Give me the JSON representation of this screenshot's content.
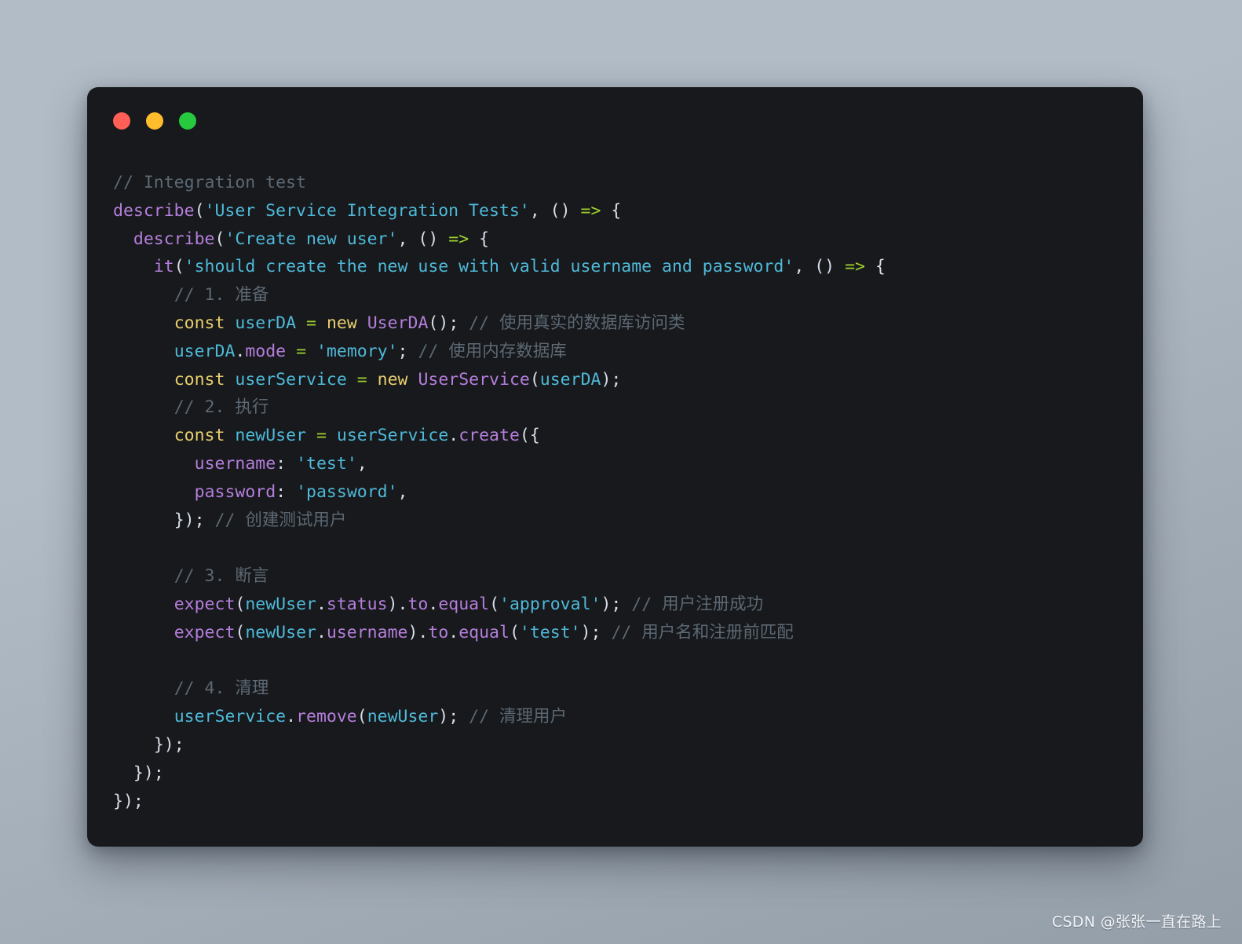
{
  "window": {
    "traffic_lights": [
      {
        "name": "close",
        "color": "#ff5f56"
      },
      {
        "name": "minimize",
        "color": "#ffbd2e"
      },
      {
        "name": "maximize",
        "color": "#27c93f"
      }
    ],
    "background_color": "#17191c"
  },
  "theme": {
    "page_background_start": "#b2bcc6",
    "page_background_end": "#949ea8",
    "comment": "#5c6873",
    "keyword": "#e8cf6e",
    "identifier": "#4fb9d8",
    "string": "#4fb9d8",
    "function": "#b57edc",
    "operator": "#9fd02f",
    "punctuation": "#d8dee9"
  },
  "code": {
    "language": "javascript",
    "lines": [
      {
        "n": 1,
        "text": "// Integration test"
      },
      {
        "n": 2,
        "text": "describe('User Service Integration Tests', () => {"
      },
      {
        "n": 3,
        "text": "  describe('Create new user', () => {"
      },
      {
        "n": 4,
        "text": "    it('should create the new use with valid username and password', () => {"
      },
      {
        "n": 5,
        "text": "      // 1. 准备"
      },
      {
        "n": 6,
        "text": "      const userDA = new UserDA(); // 使用真实的数据库访问类"
      },
      {
        "n": 7,
        "text": "      userDA.mode = 'memory'; // 使用内存数据库"
      },
      {
        "n": 8,
        "text": "      const userService = new UserService(userDA);"
      },
      {
        "n": 9,
        "text": "      // 2. 执行"
      },
      {
        "n": 10,
        "text": "      const newUser = userService.create({"
      },
      {
        "n": 11,
        "text": "        username: 'test',"
      },
      {
        "n": 12,
        "text": "        password: 'password',"
      },
      {
        "n": 13,
        "text": "      }); // 创建测试用户"
      },
      {
        "n": 14,
        "text": ""
      },
      {
        "n": 15,
        "text": "      // 3. 断言"
      },
      {
        "n": 16,
        "text": "      expect(newUser.status).to.equal('approval'); // 用户注册成功"
      },
      {
        "n": 17,
        "text": "      expect(newUser.username).to.equal('test'); // 用户名和注册前匹配"
      },
      {
        "n": 18,
        "text": ""
      },
      {
        "n": 19,
        "text": "      // 4. 清理"
      },
      {
        "n": 20,
        "text": "      userService.remove(newUser); // 清理用户"
      },
      {
        "n": 21,
        "text": "    });"
      },
      {
        "n": 22,
        "text": "  });"
      },
      {
        "n": 23,
        "text": "});"
      }
    ]
  },
  "watermark": {
    "text": "CSDN @张张一直在路上"
  }
}
